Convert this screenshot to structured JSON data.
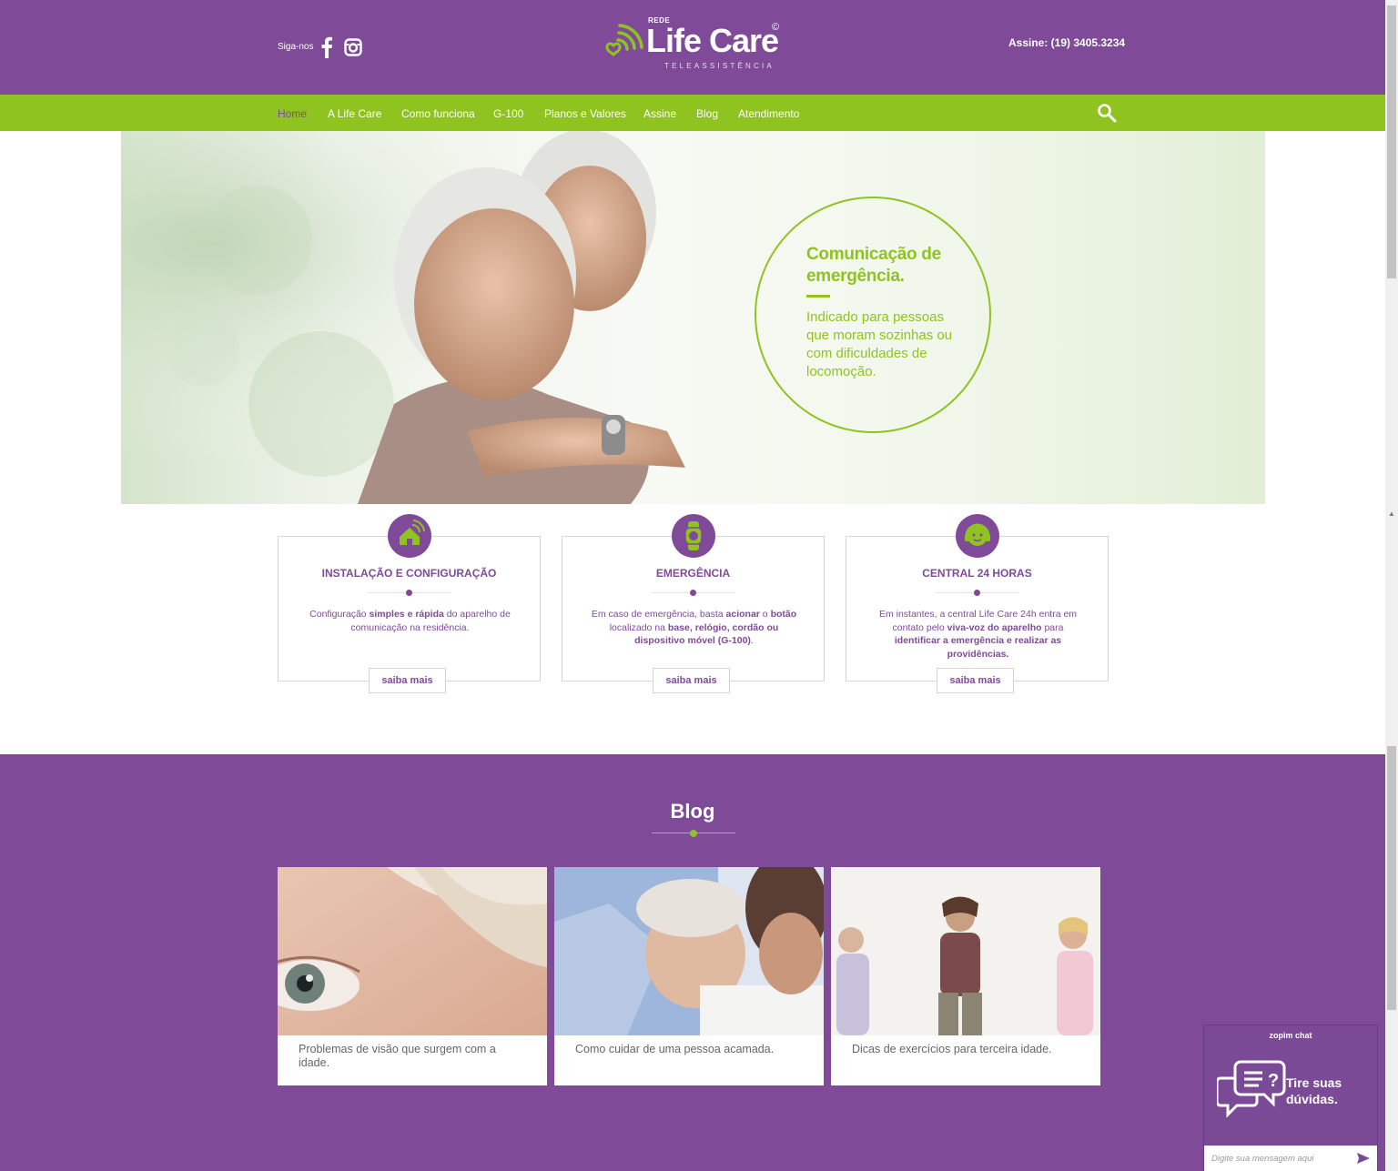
{
  "header": {
    "follow_label": "Siga-nos",
    "logo": {
      "top": "REDE",
      "name": "Life Care",
      "copyright": "©",
      "subtitle": "TELEASSISTÊNCIA"
    },
    "phone": "Assine: (19) 3405.3234"
  },
  "nav": {
    "items": [
      "Home",
      "A Life Care",
      "Como funciona",
      "G-100",
      "Planos e Valores",
      "Assine",
      "Blog",
      "Atendimento"
    ],
    "active": "Home"
  },
  "hero": {
    "title": "Comunicação de emergência.",
    "text": "Indicado para pessoas que moram sozinhas ou com dificuldades de locomoção."
  },
  "features": [
    {
      "icon": "house-signal-icon",
      "title": "INSTALAÇÃO E CONFIGURAÇÃO",
      "desc": [
        "Configuração ",
        "simples e rápida",
        " do aparelho de comunicação na residência."
      ],
      "button": "saiba mais"
    },
    {
      "icon": "watch-icon",
      "title": "EMERGÊNCIA",
      "desc": [
        "Em caso de emergência, basta ",
        "acionar",
        " o ",
        "botão",
        " localizado na ",
        "base, relógio, cordão ou dispositivo móvel (G-100)",
        "."
      ],
      "button": "saiba mais"
    },
    {
      "icon": "headset-operator-icon",
      "title": "CENTRAL 24 HORAS",
      "desc": [
        "Em instantes, a central Life Care 24h entra em contato pelo ",
        "viva-voz do aparelho",
        " para ",
        "identificar a emergência e realizar as providências."
      ],
      "button": "saiba mais"
    }
  ],
  "blog": {
    "title": "Blog",
    "posts": [
      "Problemas de visão que surgem com a idade.",
      "Como cuidar de uma pessoa acamada.",
      "Dicas de exercícios para terceira idade."
    ]
  },
  "chat": {
    "brand": "zopim chat",
    "label": "Tire suas dúvidas.",
    "placeholder": "Digite sua mensagem aqui"
  },
  "colors": {
    "purple": "#7f4a98",
    "green": "#8fc320"
  }
}
